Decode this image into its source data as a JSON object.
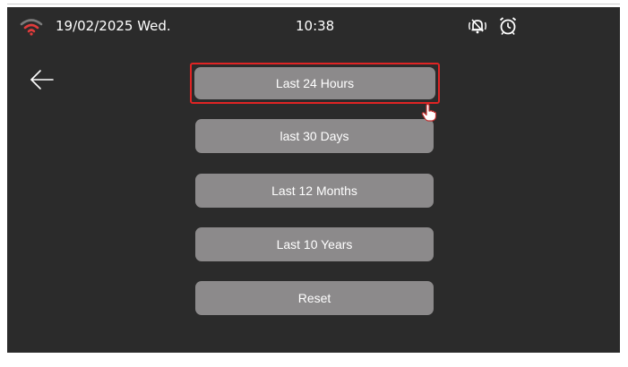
{
  "status_bar": {
    "date": "19/02/2025 Wed.",
    "time": "10:38",
    "icons": [
      "wifi-icon",
      "muted-bell-icon",
      "alarm-clock-icon"
    ]
  },
  "navigation": {
    "back_icon": "back-arrow-icon"
  },
  "menu": {
    "selected_index": 0,
    "items": [
      {
        "label": "Last 24 Hours"
      },
      {
        "label": "last 30 Days"
      },
      {
        "label": "Last 12 Months"
      },
      {
        "label": "Last 10 Years"
      },
      {
        "label": "Reset"
      }
    ]
  },
  "colors": {
    "background": "#2b2b2b",
    "button": "#8c8a8b",
    "selection_outline": "#e02424",
    "wifi_active": "#e23b3b",
    "wifi_inactive": "#7a7a7a",
    "text": "#ffffff"
  },
  "pointer": {
    "icon": "hand-pointer-icon"
  }
}
